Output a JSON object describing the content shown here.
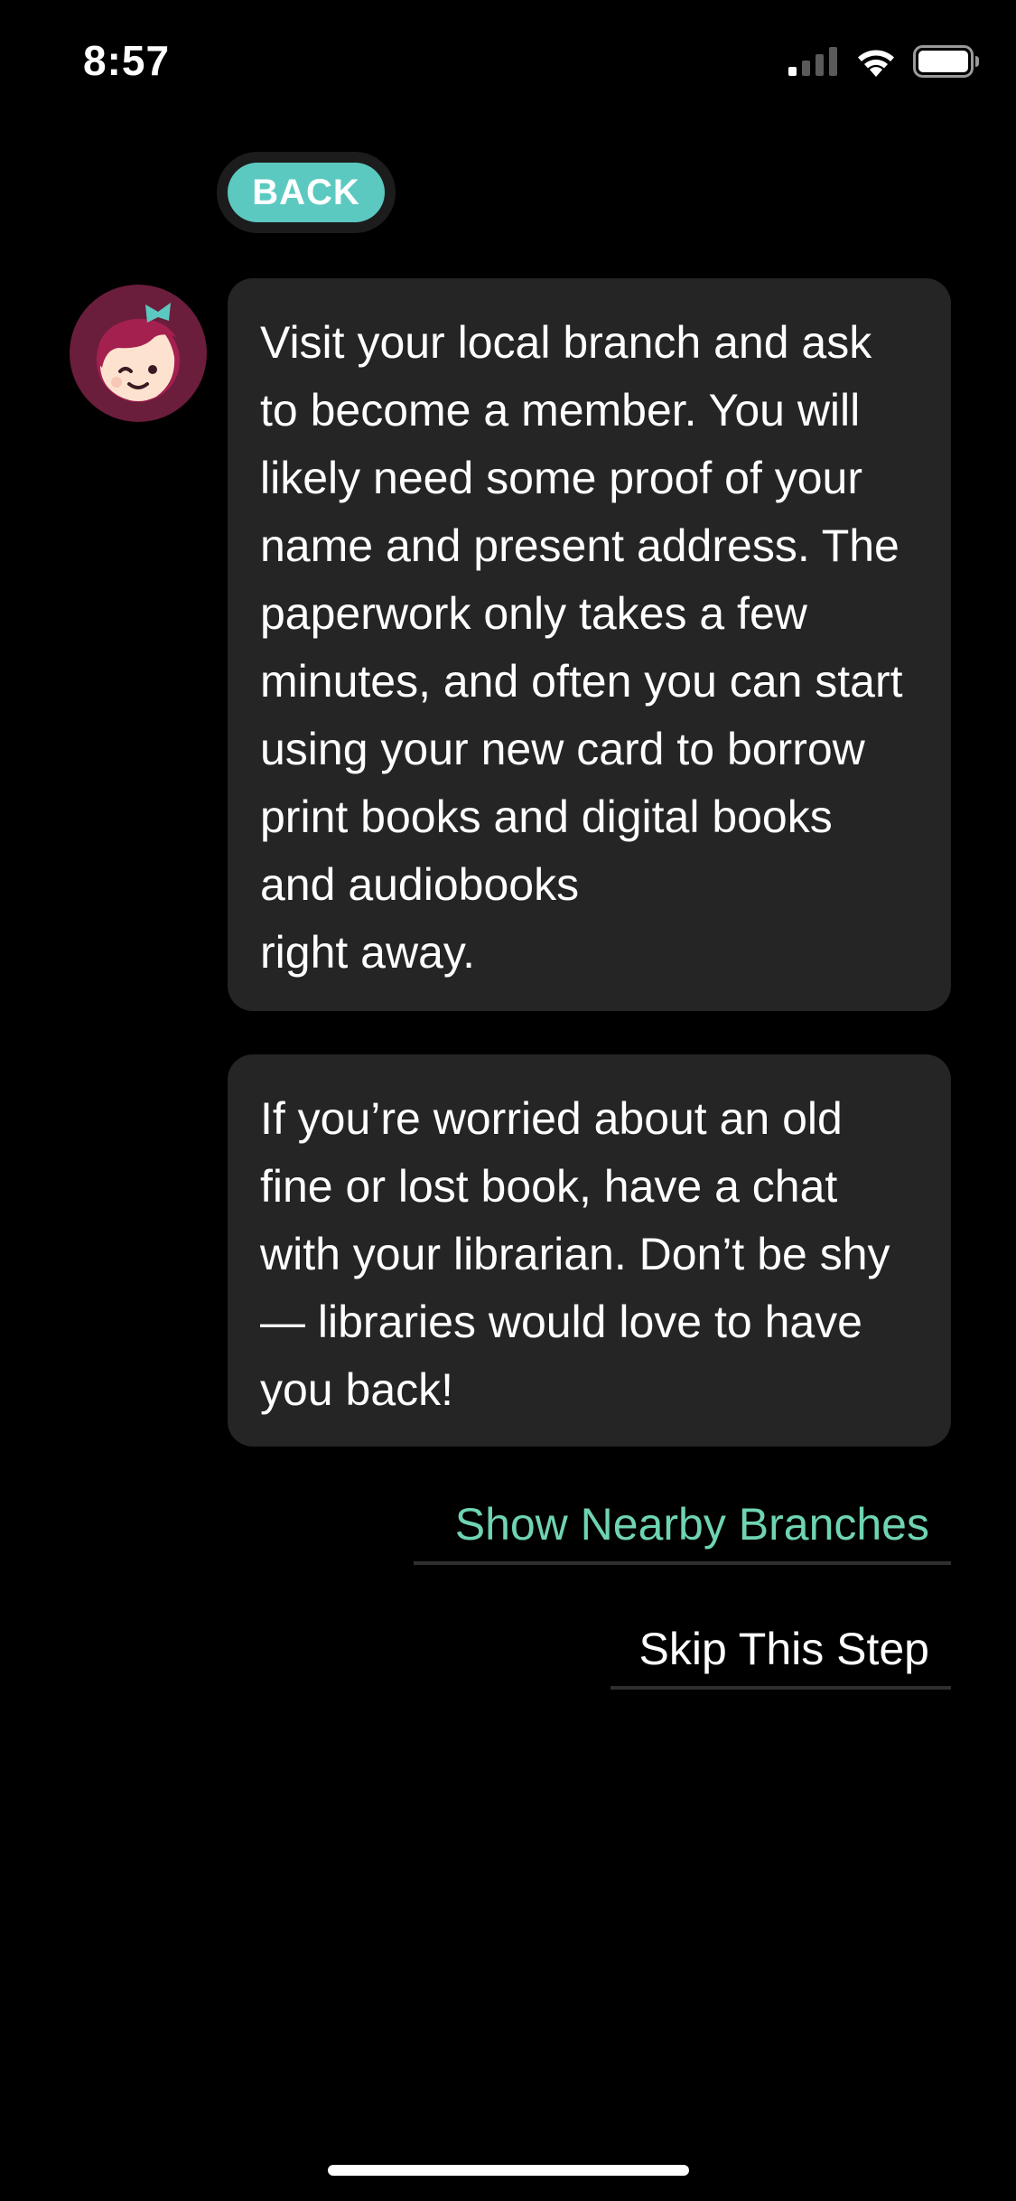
{
  "status_bar": {
    "time": "8:57",
    "icons": [
      "cellular-signal-icon",
      "wifi-icon",
      "battery-icon"
    ]
  },
  "back_button": {
    "label": "BACK"
  },
  "avatar": {
    "icon": "libby-avatar-icon",
    "colors": {
      "ring": "#6b1d3c",
      "hair": "#a3204f",
      "face": "#fde3cf",
      "bow": "#5cc9c1"
    }
  },
  "messages": [
    {
      "text": "Visit your local branch and ask to become a member. You will likely need some proof of your name and present address. The paperwork only takes a few minutes, and often you can start using your new card to borrow print books and digital books and audiobooks\nright away."
    },
    {
      "text": "If you’re worried about an old fine or lost book, have a chat with your librarian. Don’t be shy — libraries would love to have you back!"
    }
  ],
  "actions": {
    "show_nearby_branches": "Show Nearby Branches",
    "skip_this_step": "Skip This Step"
  },
  "colors": {
    "background": "#000000",
    "bubble": "#252525",
    "accent_teal": "#5cc9c1",
    "link_green": "#6fd4b0"
  }
}
